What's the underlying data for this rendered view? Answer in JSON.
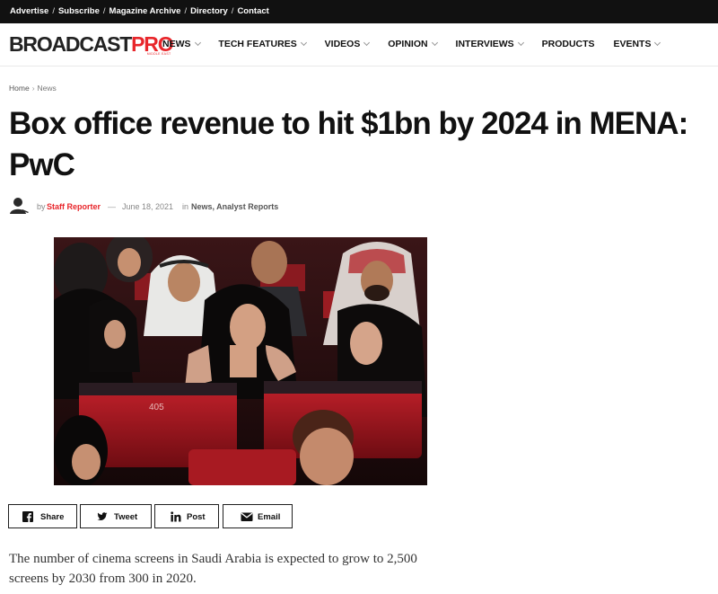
{
  "topbar": {
    "links": [
      "Advertise",
      "Subscribe",
      "Magazine Archive",
      "Directory",
      "Contact"
    ],
    "separator": "/"
  },
  "logo": {
    "part1": "BROADCAST",
    "part2": "PRO",
    "tagline": "MIDDLE EAST"
  },
  "nav": {
    "items": [
      {
        "label": "NEWS",
        "has_dropdown": true
      },
      {
        "label": "TECH FEATURES",
        "has_dropdown": true
      },
      {
        "label": "VIDEOS",
        "has_dropdown": true
      },
      {
        "label": "OPINION",
        "has_dropdown": true
      },
      {
        "label": "INTERVIEWS",
        "has_dropdown": true
      },
      {
        "label": "PRODUCTS",
        "has_dropdown": false
      },
      {
        "label": "EVENTS",
        "has_dropdown": true
      }
    ]
  },
  "breadcrumb": {
    "home": "Home",
    "arrow": "›",
    "current": "News"
  },
  "article": {
    "title": "Box office revenue to hit $1bn by 2024 in MENA: PwC",
    "by": "by",
    "author": "Staff Reporter",
    "dash": "—",
    "date": "June 18, 2021",
    "in": "in",
    "categories": "News, Analyst Reports",
    "image_seat_number": "405",
    "lead": "The number of cinema screens in Saudi Arabia is expected to grow to 2,500 screens by 2030 from 300 in 2020."
  },
  "share": {
    "facebook": "Share",
    "twitter": "Tweet",
    "linkedin": "Post",
    "email": "Email"
  },
  "colors": {
    "brand_red": "#e8262b",
    "topbar_bg": "#111111",
    "seat_red": "#b01820"
  },
  "icons": [
    "facebook-icon",
    "twitter-icon",
    "linkedin-icon",
    "email-icon",
    "chevron-down-icon",
    "author-avatar-icon"
  ]
}
